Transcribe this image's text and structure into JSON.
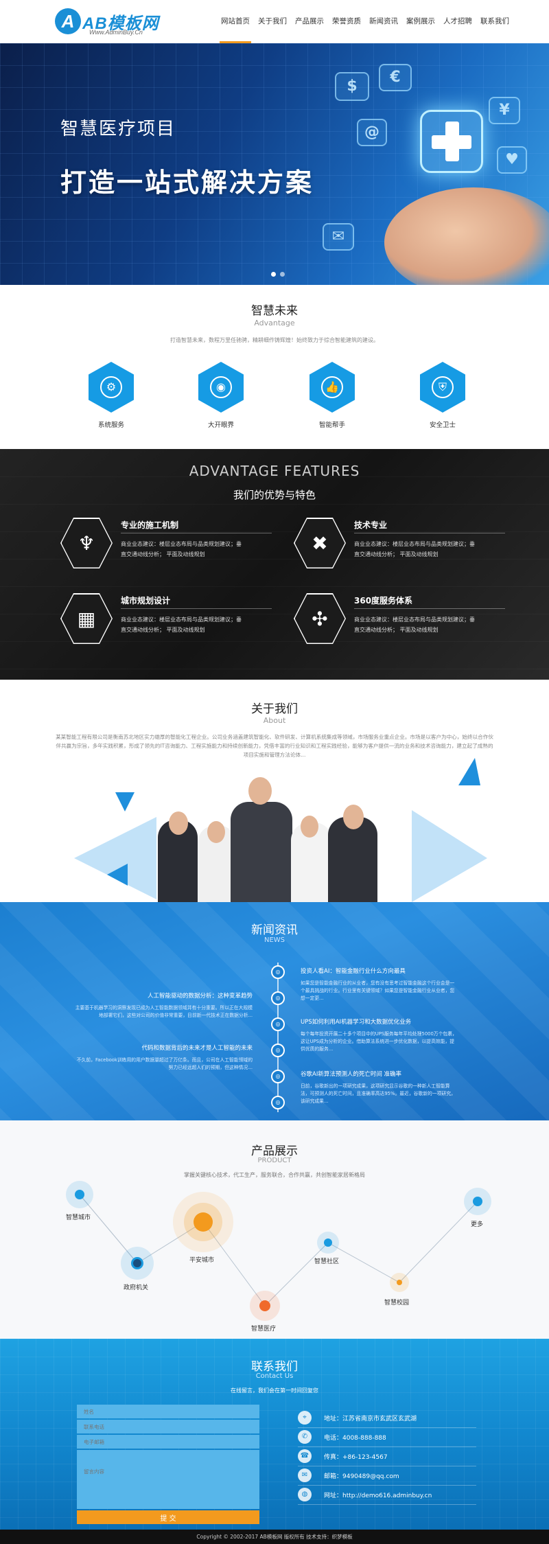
{
  "header": {
    "logo_mark": "A",
    "logo_text": "AB模板网",
    "logo_sub": "Www.AdminBuy.Cn",
    "nav": [
      "网站首页",
      "关于我们",
      "产品展示",
      "荣誉资质",
      "新闻资讯",
      "案例展示",
      "人才招聘",
      "联系我们"
    ]
  },
  "banner": {
    "title": "智慧医疗项目",
    "subtitle": "打造一站式解决方案",
    "tiles": [
      "$",
      "€",
      "¥",
      "@",
      "♥",
      "✉"
    ]
  },
  "advantage": {
    "title": "智慧未来",
    "en": "Advantage",
    "desc": "打造智慧未来，数程万里任驰骋，精耕细作铸辉煌！始终致力于综合智能建筑的建设。",
    "items": [
      {
        "label": "系统服务",
        "icon": "gear-icon",
        "glyph": "⚙"
      },
      {
        "label": "大开眼界",
        "icon": "eye-icon",
        "glyph": "◉"
      },
      {
        "label": "智能帮手",
        "icon": "thumbs-up-icon",
        "glyph": "👍"
      },
      {
        "label": "安全卫士",
        "icon": "shield-icon",
        "glyph": "⛨"
      }
    ]
  },
  "features": {
    "en": "ADVANTAGE FEATURES",
    "cn": "我们的优势与特色",
    "items": [
      {
        "title": "专业的施工机制",
        "text": "商业业态建议：楼层业态布局与品类规划建议；垂直交通动线分析； 平面及动线规划",
        "icon": "crane-icon",
        "glyph": "♆"
      },
      {
        "title": "技术专业",
        "text": "商业业态建议：楼层业态布局与品类规划建议；垂直交通动线分析； 平面及动线规划",
        "icon": "tools-icon",
        "glyph": "✖"
      },
      {
        "title": "城市规划设计",
        "text": "商业业态建议：楼层业态布局与品类规划建议；垂直交通动线分析； 平面及动线规划",
        "icon": "building-icon",
        "glyph": "▦"
      },
      {
        "title": "360度服务体系",
        "text": "商业业态建议：楼层业态布局与品类规划建议；垂直交通动线分析； 平面及动线规划",
        "icon": "windmill-icon",
        "glyph": "✣"
      }
    ]
  },
  "about": {
    "title": "关于我们",
    "en": "About",
    "text": "某某智能工程有限公司是衡南苏北地区实力雄厚的智能化工程企业。公司业务涵盖建筑智能化、软件研发、计算机系统集成等领域，市场服务业重点企业。市场是以客户为中心，始终以合作伙伴共赢为宗旨，多年实践积累，形成了领先的IT咨询能力、工程实施能力和持续创新能力，凭借丰富的行业知识和工程实践经验，能够为客户提供一流的业务和技术咨询能力，建立起了成熟的项目实施和管理方法论体..."
  },
  "news": {
    "title": "新闻资讯",
    "en": "NEWS",
    "right": [
      {
        "title": "投资人看AI：智能金融行业什么方向最具",
        "text": "如果您是智能金融行业的从业者，您有没有思考过智能金融这个行业会是一个最具挑战的行业。行业里有关键领域？如果您是智能金融行业从业者，您想一定更..."
      },
      {
        "title": "UPS如何利用AI机器学习和大数据优化业务",
        "text": "每个每年投资开展二十多个项目中的UPS服务每年平均处理5000万个包裹，这让UPS成为分析的企业。借助算法系统进一步优化数据，以提高效能，提供优质的服务..."
      },
      {
        "title": "谷歌AI新算法预测人的死亡时间 准确率",
        "text": "日前，谷歌新出的一项研究成果，这项研究显示谷歌的一种新人工智能算法，可预测人的死亡时间，且准确率高达95%。最近，谷歌新的一项研究，该研究成果..."
      }
    ],
    "left": [
      {
        "title": "人工智能驱动的数据分析：这种变革趋势",
        "text": "主要基于机器学习的洞察发现已成为人工智能数据领域并有十分重要。所以正在大规模地部署它们，这些对公司的价值非常重要，目前新一代技术正在数据分析..."
      },
      {
        "title": "代码和数据背后的未来才是人工智能的未来",
        "text": "不久前，Facebook训练用的用户数据量超过了万亿条。而且，公司在人工智能领域的努力已经远超人们的预期，但这种情况…"
      }
    ],
    "node_glyph": "◎"
  },
  "products": {
    "title": "产品展示",
    "en": "PRODUCT",
    "desc": "掌握关键核心技术，代工生产，服务联合，合作共赢，共创智能家居新格局",
    "items": [
      "智慧城市",
      "平安城市",
      "政府机关",
      "智慧医疗",
      "智慧社区",
      "智慧校园",
      "更多"
    ]
  },
  "contact": {
    "title": "联系我们",
    "en": "Contact Us",
    "desc": "在线留言，我们会在第一时间回复您",
    "fields": [
      "姓名",
      "联系电话",
      "电子邮箱"
    ],
    "message_placeholder": "留言内容",
    "submit": "提 交",
    "info": [
      {
        "icon": "location-icon",
        "glyph": "⌖",
        "text": "地址：江苏省南京市玄武区玄武湖"
      },
      {
        "icon": "phone-icon",
        "glyph": "✆",
        "text": "电话：4008-888-888"
      },
      {
        "icon": "fax-icon",
        "glyph": "☎",
        "text": "传真：+86-123-4567"
      },
      {
        "icon": "email-icon",
        "glyph": "✉",
        "text": "邮箱：9490489@qq.com"
      },
      {
        "icon": "web-icon",
        "glyph": "◍",
        "text": "网址：http://demo616.adminbuy.cn"
      }
    ]
  },
  "footer": {
    "text": "Copyright © 2002-2017 AB模板网 版权所有   技术支持：织梦模板"
  }
}
